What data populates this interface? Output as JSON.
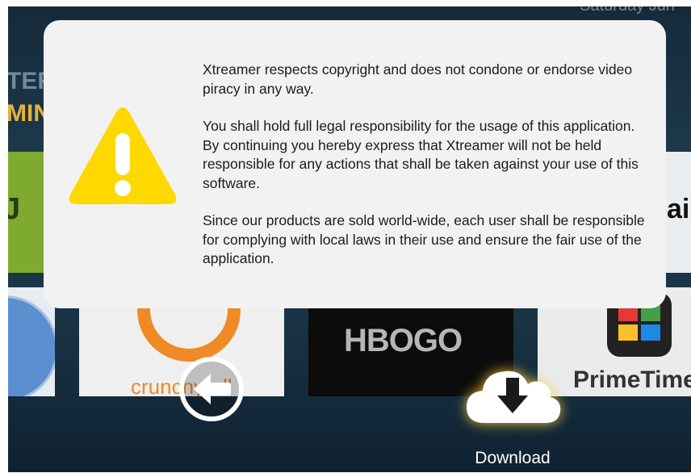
{
  "dialog": {
    "paragraphs": [
      "Xtreamer respects copyright and does not condone or endorse video piracy in any way.",
      "You shall hold full legal responsibility for the usage of this application. By continuing you hereby express that Xtreamer will not be held responsible for any actions that shall be taken against your use of this software.",
      "Since our products are sold world-wide, each user shall be responsible for complying with local laws in their use and ensure the fair use of the application."
    ],
    "icon": "warning-triangle-icon",
    "icon_color": "#ffd800"
  },
  "background": {
    "date_fragment": "Saturday Jun",
    "heading_fragment_1": "TER",
    "heading_fragment_2": "MIN",
    "tile_left_fragment": "J",
    "tile_right_fragment": "ail",
    "tiles": [
      {
        "name": "blue-disc-app"
      },
      {
        "name": "crunchyroll",
        "label": "crunchyroll"
      },
      {
        "name": "hbo-go",
        "label": "HBOGO"
      },
      {
        "name": "primetime",
        "label": "PrimeTime"
      }
    ]
  },
  "controls": {
    "back_icon": "arrow-left-icon",
    "download_icon": "cloud-download-icon",
    "download_label": "Download",
    "accent_glow": "#ffd23a"
  }
}
